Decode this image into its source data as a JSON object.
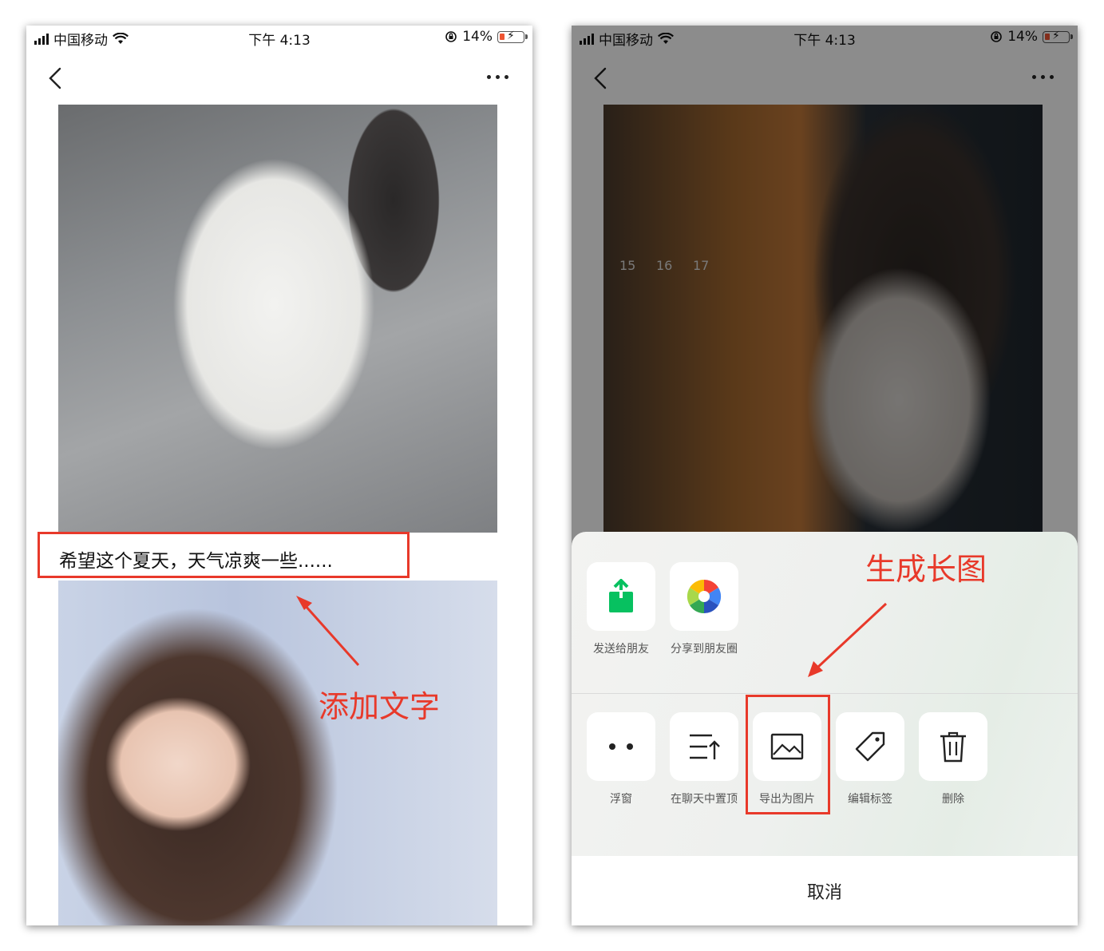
{
  "left_screen": {
    "status_bar": {
      "carrier": "中国移动",
      "time": "下午 4:13",
      "battery": "14%"
    },
    "icons": {
      "back": "chevron-left-icon",
      "more": "more-dots-icon"
    },
    "caption": "希望这个夏天，天气凉爽一些......",
    "annotation": "添加文字"
  },
  "right_screen": {
    "status_bar": {
      "carrier": "中国移动",
      "time": "下午 4:13",
      "battery": "14%"
    },
    "photo_numbers": [
      "15",
      "16",
      "17"
    ],
    "annotation": "生成长图",
    "share_actions": [
      {
        "label": "发送给朋友",
        "icon": "share-upload-icon"
      },
      {
        "label": "分享到朋友圈",
        "icon": "moments-aperture-icon"
      }
    ],
    "more_actions": [
      {
        "label": "浮窗",
        "icon": "float-window-icon"
      },
      {
        "label": "在聊天中置顶",
        "icon": "pin-top-icon"
      },
      {
        "label": "导出为图片",
        "icon": "image-icon"
      },
      {
        "label": "编辑标签",
        "icon": "tag-icon"
      },
      {
        "label": "删除",
        "icon": "trash-icon"
      }
    ],
    "cancel_label": "取消"
  },
  "colors": {
    "annotation_red": "#e8392a",
    "wechat_green": "#07c160"
  }
}
